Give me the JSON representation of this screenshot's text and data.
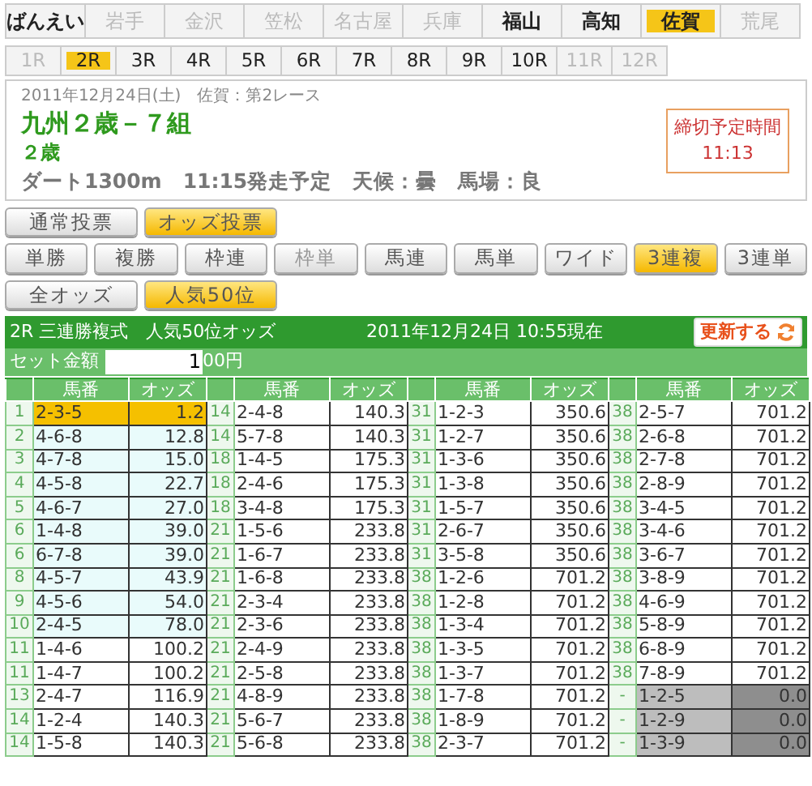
{
  "venues": [
    {
      "label": "ばんえい",
      "selected": false,
      "disabled": false
    },
    {
      "label": "岩手",
      "selected": false,
      "disabled": true
    },
    {
      "label": "金沢",
      "selected": false,
      "disabled": true
    },
    {
      "label": "笠松",
      "selected": false,
      "disabled": true
    },
    {
      "label": "名古屋",
      "selected": false,
      "disabled": true
    },
    {
      "label": "兵庫",
      "selected": false,
      "disabled": true
    },
    {
      "label": "福山",
      "selected": false,
      "disabled": false
    },
    {
      "label": "高知",
      "selected": false,
      "disabled": false
    },
    {
      "label": "佐賀",
      "selected": true,
      "disabled": false
    },
    {
      "label": "荒尾",
      "selected": false,
      "disabled": true
    }
  ],
  "races": [
    {
      "label": "1R",
      "selected": false,
      "disabled": true
    },
    {
      "label": "2R",
      "selected": true,
      "disabled": false
    },
    {
      "label": "3R",
      "selected": false,
      "disabled": false
    },
    {
      "label": "4R",
      "selected": false,
      "disabled": false
    },
    {
      "label": "5R",
      "selected": false,
      "disabled": false
    },
    {
      "label": "6R",
      "selected": false,
      "disabled": false
    },
    {
      "label": "7R",
      "selected": false,
      "disabled": false
    },
    {
      "label": "8R",
      "selected": false,
      "disabled": false
    },
    {
      "label": "9R",
      "selected": false,
      "disabled": false
    },
    {
      "label": "10R",
      "selected": false,
      "disabled": false
    },
    {
      "label": "11R",
      "selected": false,
      "disabled": true
    },
    {
      "label": "12R",
      "selected": false,
      "disabled": true
    }
  ],
  "race_info": {
    "date_line": "2011年12月24日(土)　佐賀：第2レース",
    "race_name": "九州２歳－７組",
    "age_class": "２歳",
    "details": "ダート1300m　11:15発走予定　天候：曇　馬場：良",
    "deadline": {
      "label": "締切予定時間",
      "time": "11:13"
    }
  },
  "vote_modes": [
    {
      "label": "通常投票",
      "selected": false
    },
    {
      "label": "オッズ投票",
      "selected": true
    }
  ],
  "bet_types": [
    {
      "label": "単勝",
      "selected": false,
      "disabled": false
    },
    {
      "label": "複勝",
      "selected": false,
      "disabled": false
    },
    {
      "label": "枠連",
      "selected": false,
      "disabled": false
    },
    {
      "label": "枠単",
      "selected": false,
      "disabled": true
    },
    {
      "label": "馬連",
      "selected": false,
      "disabled": false
    },
    {
      "label": "馬単",
      "selected": false,
      "disabled": false
    },
    {
      "label": "ワイド",
      "selected": false,
      "disabled": false
    },
    {
      "label": "3連複",
      "selected": true,
      "disabled": false
    },
    {
      "label": "3連単",
      "selected": false,
      "disabled": false
    }
  ],
  "views": [
    {
      "label": "全オッズ",
      "selected": false
    },
    {
      "label": "人気50位",
      "selected": true
    }
  ],
  "odds_panel": {
    "title": "2R 三連勝複式　人気50位オッズ",
    "timestamp": "2011年12月24日 10:55現在",
    "refresh_button": "更新する",
    "set_amount": {
      "label": "セット金額",
      "value": "1",
      "suffix": "00円"
    },
    "groups": [
      {
        "columns": [
          "馬番",
          "オッズ"
        ],
        "rows": [
          {
            "rank": "1",
            "combo": "2-3-5",
            "odds": "1.2",
            "highlighted": true,
            "shaded": false,
            "cancelled": false
          },
          {
            "rank": "2",
            "combo": "4-6-8",
            "odds": "12.8",
            "highlighted": false,
            "shaded": true,
            "cancelled": false
          },
          {
            "rank": "3",
            "combo": "4-7-8",
            "odds": "15.0",
            "highlighted": false,
            "shaded": true,
            "cancelled": false
          },
          {
            "rank": "4",
            "combo": "4-5-8",
            "odds": "22.7",
            "highlighted": false,
            "shaded": true,
            "cancelled": false
          },
          {
            "rank": "5",
            "combo": "4-6-7",
            "odds": "27.0",
            "highlighted": false,
            "shaded": true,
            "cancelled": false
          },
          {
            "rank": "6",
            "combo": "1-4-8",
            "odds": "39.0",
            "highlighted": false,
            "shaded": true,
            "cancelled": false
          },
          {
            "rank": "6",
            "combo": "6-7-8",
            "odds": "39.0",
            "highlighted": false,
            "shaded": true,
            "cancelled": false
          },
          {
            "rank": "8",
            "combo": "4-5-7",
            "odds": "43.9",
            "highlighted": false,
            "shaded": true,
            "cancelled": false
          },
          {
            "rank": "9",
            "combo": "4-5-6",
            "odds": "54.0",
            "highlighted": false,
            "shaded": true,
            "cancelled": false
          },
          {
            "rank": "10",
            "combo": "2-4-5",
            "odds": "78.0",
            "highlighted": false,
            "shaded": true,
            "cancelled": false
          },
          {
            "rank": "11",
            "combo": "1-4-6",
            "odds": "100.2",
            "highlighted": false,
            "shaded": false,
            "cancelled": false
          },
          {
            "rank": "11",
            "combo": "1-4-7",
            "odds": "100.2",
            "highlighted": false,
            "shaded": false,
            "cancelled": false
          },
          {
            "rank": "13",
            "combo": "2-4-7",
            "odds": "116.9",
            "highlighted": false,
            "shaded": false,
            "cancelled": false
          },
          {
            "rank": "14",
            "combo": "1-2-4",
            "odds": "140.3",
            "highlighted": false,
            "shaded": false,
            "cancelled": false
          },
          {
            "rank": "14",
            "combo": "1-5-8",
            "odds": "140.3",
            "highlighted": false,
            "shaded": false,
            "cancelled": false
          }
        ]
      },
      {
        "columns": [
          "馬番",
          "オッズ"
        ],
        "rows": [
          {
            "rank": "14",
            "combo": "2-4-8",
            "odds": "140.3",
            "highlighted": false,
            "shaded": false,
            "cancelled": false
          },
          {
            "rank": "14",
            "combo": "5-7-8",
            "odds": "140.3",
            "highlighted": false,
            "shaded": false,
            "cancelled": false
          },
          {
            "rank": "18",
            "combo": "1-4-5",
            "odds": "175.3",
            "highlighted": false,
            "shaded": false,
            "cancelled": false
          },
          {
            "rank": "18",
            "combo": "2-4-6",
            "odds": "175.3",
            "highlighted": false,
            "shaded": false,
            "cancelled": false
          },
          {
            "rank": "18",
            "combo": "3-4-8",
            "odds": "175.3",
            "highlighted": false,
            "shaded": false,
            "cancelled": false
          },
          {
            "rank": "21",
            "combo": "1-5-6",
            "odds": "233.8",
            "highlighted": false,
            "shaded": false,
            "cancelled": false
          },
          {
            "rank": "21",
            "combo": "1-6-7",
            "odds": "233.8",
            "highlighted": false,
            "shaded": false,
            "cancelled": false
          },
          {
            "rank": "21",
            "combo": "1-6-8",
            "odds": "233.8",
            "highlighted": false,
            "shaded": false,
            "cancelled": false
          },
          {
            "rank": "21",
            "combo": "2-3-4",
            "odds": "233.8",
            "highlighted": false,
            "shaded": false,
            "cancelled": false
          },
          {
            "rank": "21",
            "combo": "2-3-6",
            "odds": "233.8",
            "highlighted": false,
            "shaded": false,
            "cancelled": false
          },
          {
            "rank": "21",
            "combo": "2-4-9",
            "odds": "233.8",
            "highlighted": false,
            "shaded": false,
            "cancelled": false
          },
          {
            "rank": "21",
            "combo": "2-5-8",
            "odds": "233.8",
            "highlighted": false,
            "shaded": false,
            "cancelled": false
          },
          {
            "rank": "21",
            "combo": "4-8-9",
            "odds": "233.8",
            "highlighted": false,
            "shaded": false,
            "cancelled": false
          },
          {
            "rank": "21",
            "combo": "5-6-7",
            "odds": "233.8",
            "highlighted": false,
            "shaded": false,
            "cancelled": false
          },
          {
            "rank": "21",
            "combo": "5-6-8",
            "odds": "233.8",
            "highlighted": false,
            "shaded": false,
            "cancelled": false
          }
        ]
      },
      {
        "columns": [
          "馬番",
          "オッズ"
        ],
        "rows": [
          {
            "rank": "31",
            "combo": "1-2-3",
            "odds": "350.6",
            "highlighted": false,
            "shaded": false,
            "cancelled": false
          },
          {
            "rank": "31",
            "combo": "1-2-7",
            "odds": "350.6",
            "highlighted": false,
            "shaded": false,
            "cancelled": false
          },
          {
            "rank": "31",
            "combo": "1-3-6",
            "odds": "350.6",
            "highlighted": false,
            "shaded": false,
            "cancelled": false
          },
          {
            "rank": "31",
            "combo": "1-3-8",
            "odds": "350.6",
            "highlighted": false,
            "shaded": false,
            "cancelled": false
          },
          {
            "rank": "31",
            "combo": "1-5-7",
            "odds": "350.6",
            "highlighted": false,
            "shaded": false,
            "cancelled": false
          },
          {
            "rank": "31",
            "combo": "2-6-7",
            "odds": "350.6",
            "highlighted": false,
            "shaded": false,
            "cancelled": false
          },
          {
            "rank": "31",
            "combo": "3-5-8",
            "odds": "350.6",
            "highlighted": false,
            "shaded": false,
            "cancelled": false
          },
          {
            "rank": "38",
            "combo": "1-2-6",
            "odds": "701.2",
            "highlighted": false,
            "shaded": false,
            "cancelled": false
          },
          {
            "rank": "38",
            "combo": "1-2-8",
            "odds": "701.2",
            "highlighted": false,
            "shaded": false,
            "cancelled": false
          },
          {
            "rank": "38",
            "combo": "1-3-4",
            "odds": "701.2",
            "highlighted": false,
            "shaded": false,
            "cancelled": false
          },
          {
            "rank": "38",
            "combo": "1-3-5",
            "odds": "701.2",
            "highlighted": false,
            "shaded": false,
            "cancelled": false
          },
          {
            "rank": "38",
            "combo": "1-3-7",
            "odds": "701.2",
            "highlighted": false,
            "shaded": false,
            "cancelled": false
          },
          {
            "rank": "38",
            "combo": "1-7-8",
            "odds": "701.2",
            "highlighted": false,
            "shaded": false,
            "cancelled": false
          },
          {
            "rank": "38",
            "combo": "1-8-9",
            "odds": "701.2",
            "highlighted": false,
            "shaded": false,
            "cancelled": false
          },
          {
            "rank": "38",
            "combo": "2-3-7",
            "odds": "701.2",
            "highlighted": false,
            "shaded": false,
            "cancelled": false
          }
        ]
      },
      {
        "columns": [
          "馬番",
          "オッズ"
        ],
        "rows": [
          {
            "rank": "38",
            "combo": "2-5-7",
            "odds": "701.2",
            "highlighted": false,
            "shaded": false,
            "cancelled": false
          },
          {
            "rank": "38",
            "combo": "2-6-8",
            "odds": "701.2",
            "highlighted": false,
            "shaded": false,
            "cancelled": false
          },
          {
            "rank": "38",
            "combo": "2-7-8",
            "odds": "701.2",
            "highlighted": false,
            "shaded": false,
            "cancelled": false
          },
          {
            "rank": "38",
            "combo": "2-8-9",
            "odds": "701.2",
            "highlighted": false,
            "shaded": false,
            "cancelled": false
          },
          {
            "rank": "38",
            "combo": "3-4-5",
            "odds": "701.2",
            "highlighted": false,
            "shaded": false,
            "cancelled": false
          },
          {
            "rank": "38",
            "combo": "3-4-6",
            "odds": "701.2",
            "highlighted": false,
            "shaded": false,
            "cancelled": false
          },
          {
            "rank": "38",
            "combo": "3-6-7",
            "odds": "701.2",
            "highlighted": false,
            "shaded": false,
            "cancelled": false
          },
          {
            "rank": "38",
            "combo": "3-8-9",
            "odds": "701.2",
            "highlighted": false,
            "shaded": false,
            "cancelled": false
          },
          {
            "rank": "38",
            "combo": "4-6-9",
            "odds": "701.2",
            "highlighted": false,
            "shaded": false,
            "cancelled": false
          },
          {
            "rank": "38",
            "combo": "5-8-9",
            "odds": "701.2",
            "highlighted": false,
            "shaded": false,
            "cancelled": false
          },
          {
            "rank": "38",
            "combo": "6-8-9",
            "odds": "701.2",
            "highlighted": false,
            "shaded": false,
            "cancelled": false
          },
          {
            "rank": "38",
            "combo": "7-8-9",
            "odds": "701.2",
            "highlighted": false,
            "shaded": false,
            "cancelled": false
          },
          {
            "rank": "-",
            "combo": "1-2-5",
            "odds": "0.0",
            "highlighted": false,
            "shaded": false,
            "cancelled": true
          },
          {
            "rank": "-",
            "combo": "1-2-9",
            "odds": "0.0",
            "highlighted": false,
            "shaded": false,
            "cancelled": true
          },
          {
            "rank": "-",
            "combo": "1-3-9",
            "odds": "0.0",
            "highlighted": false,
            "shaded": false,
            "cancelled": true
          }
        ]
      }
    ]
  }
}
